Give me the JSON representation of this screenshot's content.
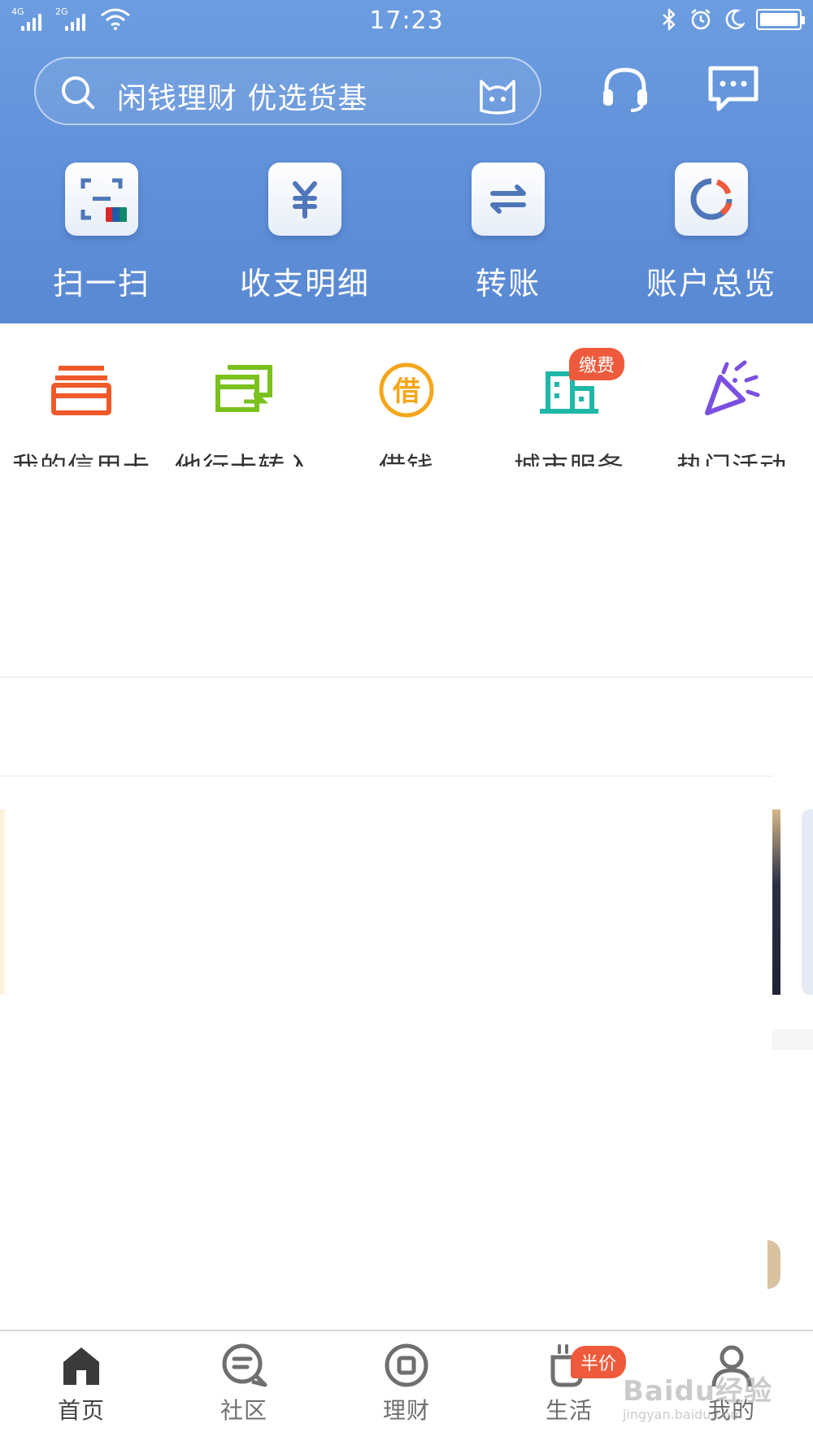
{
  "status_bar": {
    "time": "17:23",
    "signal_1_tag": "4G",
    "signal_2_tag": "2G",
    "icons": [
      "signal-4g-icon",
      "signal-2g-icon",
      "wifi-icon",
      "bluetooth-icon",
      "alarm-icon",
      "moon-icon",
      "battery-icon"
    ]
  },
  "header": {
    "search_placeholder": "闲钱理财 优选货基",
    "icons": [
      "search-icon",
      "mascot-icon",
      "headset-icon",
      "message-icon"
    ],
    "quick_actions": [
      {
        "label": "扫一扫",
        "icon": "scan-icon"
      },
      {
        "label": "收支明细",
        "icon": "yuan-icon"
      },
      {
        "label": "转账",
        "icon": "transfer-icon"
      },
      {
        "label": "账户总览",
        "icon": "overview-ring-icon"
      }
    ]
  },
  "services": [
    {
      "label": "我的信用卡",
      "icon": "credit-card-icon",
      "color": "#ef5a2a"
    },
    {
      "label": "他行卡转入",
      "icon": "card-transfer-in-icon",
      "color": "#7ac11d"
    },
    {
      "label": "借钱",
      "icon": "borrow-icon",
      "color": "#f5a61b",
      "glyph": "借"
    },
    {
      "label": "城市服务",
      "icon": "city-building-icon",
      "color": "#1fb7a8",
      "badge": "缴费"
    },
    {
      "label": "热门活动",
      "icon": "party-popper-icon",
      "color": "#7b4fe0"
    }
  ],
  "bottom_nav": [
    {
      "label": "首页",
      "icon": "home-icon",
      "active": true
    },
    {
      "label": "社区",
      "icon": "community-chat-icon",
      "active": false
    },
    {
      "label": "理财",
      "icon": "wealth-icon",
      "active": false
    },
    {
      "label": "生活",
      "icon": "life-cup-icon",
      "active": false,
      "badge": "半价"
    },
    {
      "label": "我的",
      "icon": "profile-icon",
      "active": false
    }
  ],
  "watermark": {
    "big": "Baidu经验",
    "small": "jingyan.baidu.com"
  },
  "colors": {
    "header_blue": "#5f8fd8",
    "badge_red": "#ef5a3c"
  }
}
